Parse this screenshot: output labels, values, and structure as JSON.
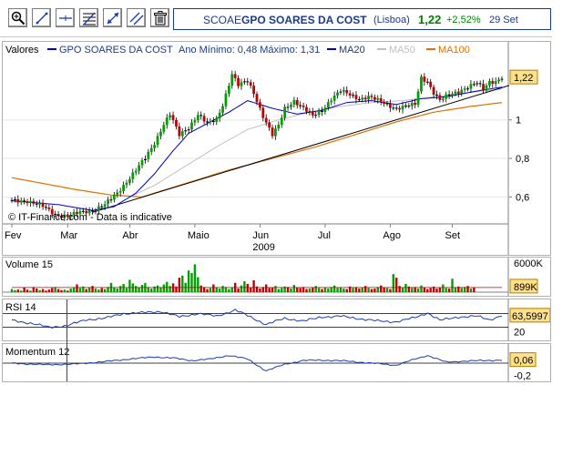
{
  "toolbar": {
    "tools": [
      {
        "name": "zoom-in-tool",
        "icon": "magnifier-plus-icon"
      },
      {
        "name": "line-tool",
        "icon": "diagonal-line-icon"
      },
      {
        "name": "horizontal-line-tool",
        "icon": "horizontal-line-icon"
      },
      {
        "name": "fibonacci-tool",
        "icon": "fibonacci-icon"
      },
      {
        "name": "trend-channel-tool",
        "icon": "trend-arrows-icon"
      },
      {
        "name": "parallel-line-tool",
        "icon": "parallel-lines-icon"
      },
      {
        "name": "delete-tool",
        "icon": "trash-icon"
      }
    ]
  },
  "quote": {
    "symbol": "SCOAE",
    "name": "GPO SOARES DA COST",
    "exchange": "(Lisboa)",
    "price": "1,22",
    "change": "+2,52%",
    "date": "29 Set"
  },
  "colors": {
    "price_series": "#0000c0",
    "ma20": "#0000c0",
    "ma50": "#c0c0c0",
    "ma100": "#e07000",
    "up_candle": "#00a000",
    "down_candle": "#c00000",
    "current_label_bg": "#ffe08a",
    "highlight_line": "#e00000"
  },
  "chart_data": [
    {
      "type": "candlestick",
      "legend": {
        "title": "Valores",
        "series_label": "GPO SOARES DA COST",
        "range_text": "Ano Mínimo: 0,48 Máximo: 1,31",
        "ma20": "MA20",
        "ma50": "MA50",
        "ma100": "MA100"
      },
      "x_ticks": [
        "Fev",
        "Mar",
        "Abr",
        "Maio",
        "Jun",
        "Jul",
        "Ago",
        "Set"
      ],
      "year_label": "2009",
      "y_ticks": [
        "1",
        "0,8",
        "0,6"
      ],
      "ylim": [
        0.46,
        1.32
      ],
      "current_value_label": "1,22",
      "watermark": "© IT-Finance.com - Data is indicative",
      "series": {
        "close_anchors": [
          [
            0,
            0.58
          ],
          [
            5,
            0.58
          ],
          [
            10,
            0.55
          ],
          [
            14,
            0.51
          ],
          [
            18,
            0.5
          ],
          [
            22,
            0.52
          ],
          [
            26,
            0.53
          ],
          [
            30,
            0.56
          ],
          [
            34,
            0.62
          ],
          [
            37,
            0.68
          ],
          [
            40,
            0.74
          ],
          [
            43,
            0.8
          ],
          [
            46,
            0.88
          ],
          [
            49,
            0.98
          ],
          [
            51,
            1.03
          ],
          [
            54,
            0.92
          ],
          [
            57,
            0.96
          ],
          [
            60,
            1.03
          ],
          [
            63,
            0.98
          ],
          [
            66,
            1.0
          ],
          [
            68,
            1.08
          ],
          [
            71,
            1.24
          ],
          [
            73,
            1.18
          ],
          [
            76,
            1.2
          ],
          [
            78,
            1.14
          ],
          [
            81,
            1.02
          ],
          [
            84,
            0.92
          ],
          [
            86,
            0.97
          ],
          [
            88,
            1.06
          ],
          [
            91,
            1.1
          ],
          [
            94,
            1.06
          ],
          [
            97,
            1.02
          ],
          [
            100,
            1.05
          ],
          [
            103,
            1.11
          ],
          [
            106,
            1.15
          ],
          [
            109,
            1.13
          ],
          [
            112,
            1.11
          ],
          [
            115,
            1.12
          ],
          [
            118,
            1.1
          ],
          [
            121,
            1.08
          ],
          [
            124,
            1.06
          ],
          [
            127,
            1.07
          ],
          [
            130,
            1.08
          ],
          [
            132,
            1.22
          ],
          [
            134,
            1.2
          ],
          [
            136,
            1.14
          ],
          [
            138,
            1.1
          ],
          [
            141,
            1.13
          ],
          [
            144,
            1.15
          ],
          [
            147,
            1.17
          ],
          [
            150,
            1.19
          ],
          [
            152,
            1.16
          ],
          [
            154,
            1.2
          ],
          [
            156,
            1.2
          ],
          [
            158,
            1.22
          ]
        ],
        "ma20_anchors": [
          [
            0,
            0.58
          ],
          [
            15,
            0.56
          ],
          [
            26,
            0.53
          ],
          [
            33,
            0.55
          ],
          [
            40,
            0.62
          ],
          [
            46,
            0.72
          ],
          [
            52,
            0.84
          ],
          [
            57,
            0.93
          ],
          [
            64,
            0.99
          ],
          [
            70,
            1.04
          ],
          [
            76,
            1.1
          ],
          [
            84,
            1.06
          ],
          [
            92,
            1.03
          ],
          [
            100,
            1.05
          ],
          [
            108,
            1.09
          ],
          [
            116,
            1.1
          ],
          [
            124,
            1.08
          ],
          [
            132,
            1.11
          ],
          [
            140,
            1.12
          ],
          [
            150,
            1.15
          ],
          [
            158,
            1.17
          ]
        ],
        "ma50_anchors": [
          [
            38,
            0.6
          ],
          [
            46,
            0.66
          ],
          [
            56,
            0.76
          ],
          [
            66,
            0.86
          ],
          [
            76,
            0.95
          ],
          [
            86,
            1.0
          ],
          [
            96,
            1.04
          ],
          [
            106,
            1.07
          ],
          [
            116,
            1.09
          ],
          [
            126,
            1.1
          ],
          [
            136,
            1.12
          ],
          [
            146,
            1.14
          ],
          [
            158,
            1.16
          ]
        ],
        "ma100_anchors": [
          [
            0,
            0.7
          ],
          [
            10,
            0.67
          ],
          [
            20,
            0.64
          ],
          [
            32,
            0.61
          ],
          [
            42,
            0.6
          ],
          [
            56,
            0.67
          ],
          [
            70,
            0.74
          ],
          [
            84,
            0.8
          ],
          [
            98,
            0.86
          ],
          [
            112,
            0.93
          ],
          [
            124,
            0.99
          ],
          [
            136,
            1.04
          ],
          [
            148,
            1.07
          ],
          [
            158,
            1.09
          ]
        ],
        "trendline": [
          [
            26,
            0.52
          ],
          [
            158,
            1.16
          ]
        ]
      }
    },
    {
      "type": "bar",
      "title": "Volume 15",
      "y_ticks": [
        "6000K"
      ],
      "current_value_label": "899K",
      "ylim": [
        0,
        6000
      ],
      "values": [
        600,
        400,
        500,
        300,
        900,
        500,
        300,
        1000,
        700,
        400,
        600,
        300,
        500,
        800,
        1000,
        600,
        400,
        500,
        300,
        700,
        900,
        1500,
        800,
        1100,
        600,
        900,
        1200,
        700,
        500,
        800,
        600,
        1000,
        1800,
        900,
        700,
        1200,
        1600,
        800,
        2400,
        1700,
        1200,
        900,
        1400,
        1800,
        1000,
        700,
        1100,
        1300,
        900,
        1500,
        2000,
        1200,
        1700,
        1100,
        2800,
        3200,
        1800,
        4200,
        3700,
        5400,
        2900,
        1300,
        1000,
        600,
        800,
        1500,
        900,
        700,
        1200,
        1000,
        600,
        900,
        1800,
        700,
        1300,
        2100,
        1600,
        900,
        2300,
        1100,
        700,
        1000,
        1500,
        800,
        900,
        1200,
        600,
        800,
        1100,
        1000,
        700,
        1400,
        900,
        800,
        1000,
        600,
        700,
        900,
        1200,
        800,
        600,
        900,
        700,
        1000,
        1300,
        800,
        900,
        700,
        600,
        1100,
        800,
        1000,
        700,
        900,
        1200,
        800,
        600,
        700,
        1000,
        1300,
        900,
        800,
        600,
        3500,
        2800,
        1200,
        900,
        1600,
        1100,
        800,
        1000,
        700,
        1300,
        900,
        600,
        800,
        1100,
        700,
        900,
        1500,
        800,
        700,
        2600,
        900,
        1100,
        800,
        1000,
        1200,
        700,
        900
      ],
      "up": "alternate",
      "ma_line_level": 900
    },
    {
      "type": "line",
      "title": "RSI 14",
      "y_ticks": [
        "20"
      ],
      "current_value_label": "63,5997",
      "ylim": [
        0,
        100
      ],
      "anchors": [
        [
          0,
          50
        ],
        [
          6,
          42
        ],
        [
          12,
          30
        ],
        [
          18,
          35
        ],
        [
          24,
          52
        ],
        [
          30,
          56
        ],
        [
          36,
          70
        ],
        [
          42,
          72
        ],
        [
          48,
          76
        ],
        [
          54,
          60
        ],
        [
          60,
          70
        ],
        [
          66,
          62
        ],
        [
          72,
          80
        ],
        [
          76,
          64
        ],
        [
          82,
          38
        ],
        [
          88,
          56
        ],
        [
          94,
          48
        ],
        [
          100,
          60
        ],
        [
          106,
          62
        ],
        [
          112,
          55
        ],
        [
          118,
          48
        ],
        [
          124,
          46
        ],
        [
          130,
          58
        ],
        [
          134,
          72
        ],
        [
          138,
          50
        ],
        [
          144,
          60
        ],
        [
          150,
          62
        ],
        [
          154,
          52
        ],
        [
          158,
          64
        ]
      ]
    },
    {
      "type": "line",
      "title": "Momentum 12",
      "y_ticks": [
        "-0,2"
      ],
      "current_value_label": "0,06",
      "ylim": [
        -0.3,
        0.3
      ],
      "anchors": [
        [
          0,
          0.0
        ],
        [
          10,
          -0.03
        ],
        [
          20,
          -0.02
        ],
        [
          30,
          0.03
        ],
        [
          38,
          0.08
        ],
        [
          46,
          0.12
        ],
        [
          52,
          0.1
        ],
        [
          58,
          0.05
        ],
        [
          64,
          0.08
        ],
        [
          70,
          0.15
        ],
        [
          76,
          0.08
        ],
        [
          82,
          -0.15
        ],
        [
          88,
          -0.02
        ],
        [
          94,
          0.05
        ],
        [
          100,
          0.06
        ],
        [
          108,
          0.04
        ],
        [
          116,
          0.0
        ],
        [
          124,
          -0.04
        ],
        [
          130,
          0.08
        ],
        [
          134,
          0.15
        ],
        [
          140,
          0.02
        ],
        [
          146,
          0.04
        ],
        [
          152,
          0.05
        ],
        [
          158,
          0.06
        ]
      ]
    }
  ]
}
